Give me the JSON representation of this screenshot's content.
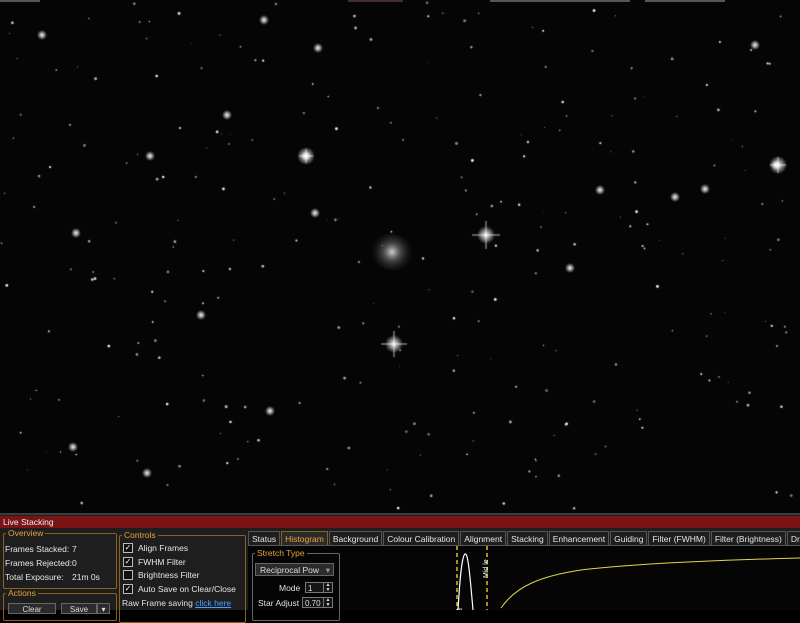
{
  "panel": {
    "title": "Live Stacking"
  },
  "overview": {
    "legend": "Overview",
    "rows": [
      {
        "label": "Frames Stacked:",
        "value": "7"
      },
      {
        "label": "Frames Rejected:",
        "value": "0"
      },
      {
        "label": "Total Exposure:",
        "value": "21m 0s"
      }
    ]
  },
  "actions": {
    "legend": "Actions",
    "clear_label": "Clear",
    "save_label": "Save"
  },
  "controls": {
    "legend": "Controls",
    "items": [
      {
        "label": "Align Frames",
        "checked": true
      },
      {
        "label": "FWHM Filter",
        "checked": true
      },
      {
        "label": "Brightness Filter",
        "checked": false
      },
      {
        "label": "Auto Save on Clear/Close",
        "checked": true
      }
    ],
    "raw_saving_label": "Raw Frame saving",
    "raw_saving_link": "click here"
  },
  "tabs": [
    "Status",
    "Histogram",
    "Background",
    "Colour Calibration",
    "Alignment",
    "Stacking",
    "Enhancement",
    "Guiding",
    "Filter (FWHM)",
    "Filter (Brightness)",
    "Drift C"
  ],
  "active_tab": "Histogram",
  "histogram": {
    "stretch_legend": "Stretch Type",
    "stretch_value": "Reciprocal Pow",
    "mode_label": "Mode",
    "mode_value": "1",
    "star_adjust_label": "Star Adjust",
    "star_adjust_value": "0.70",
    "marker_black": "Bl",
    "marker_mid": "Mid le",
    "colors": {
      "marker": "#f0e020",
      "curve": "#e0d84a",
      "peak": "#ffffff"
    }
  },
  "colors": {
    "accent": "#e6a23c",
    "title_bar": "#7a1414",
    "link": "#4aa3ff",
    "panel_bg": "#1e1e1e"
  },
  "icons": {
    "check": "check-icon",
    "spin_arrows": "spin-arrows-icon",
    "dropdown": "chevron-down-icon"
  }
}
